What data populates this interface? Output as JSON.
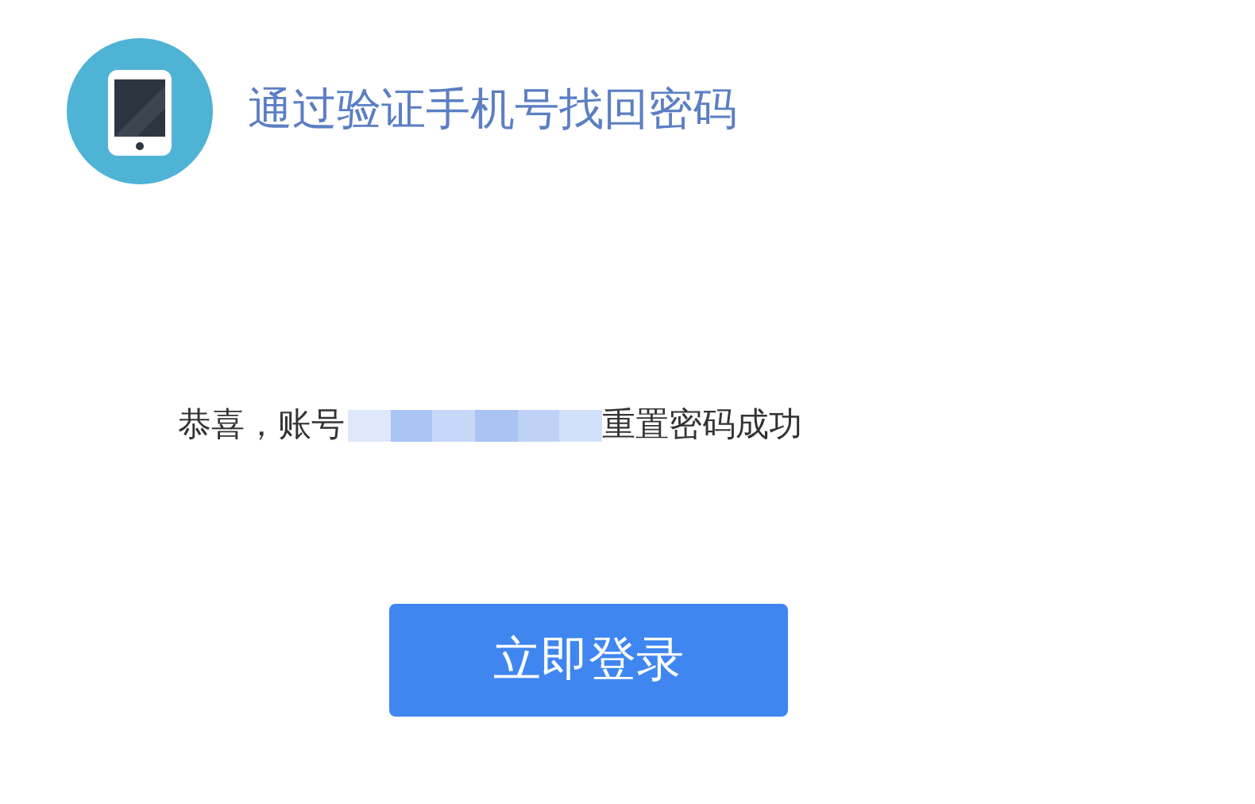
{
  "header": {
    "title": "通过验证手机号找回密码"
  },
  "message": {
    "before": "恭喜，账号",
    "after": "重置密码成功"
  },
  "button": {
    "label": "立即登录"
  }
}
